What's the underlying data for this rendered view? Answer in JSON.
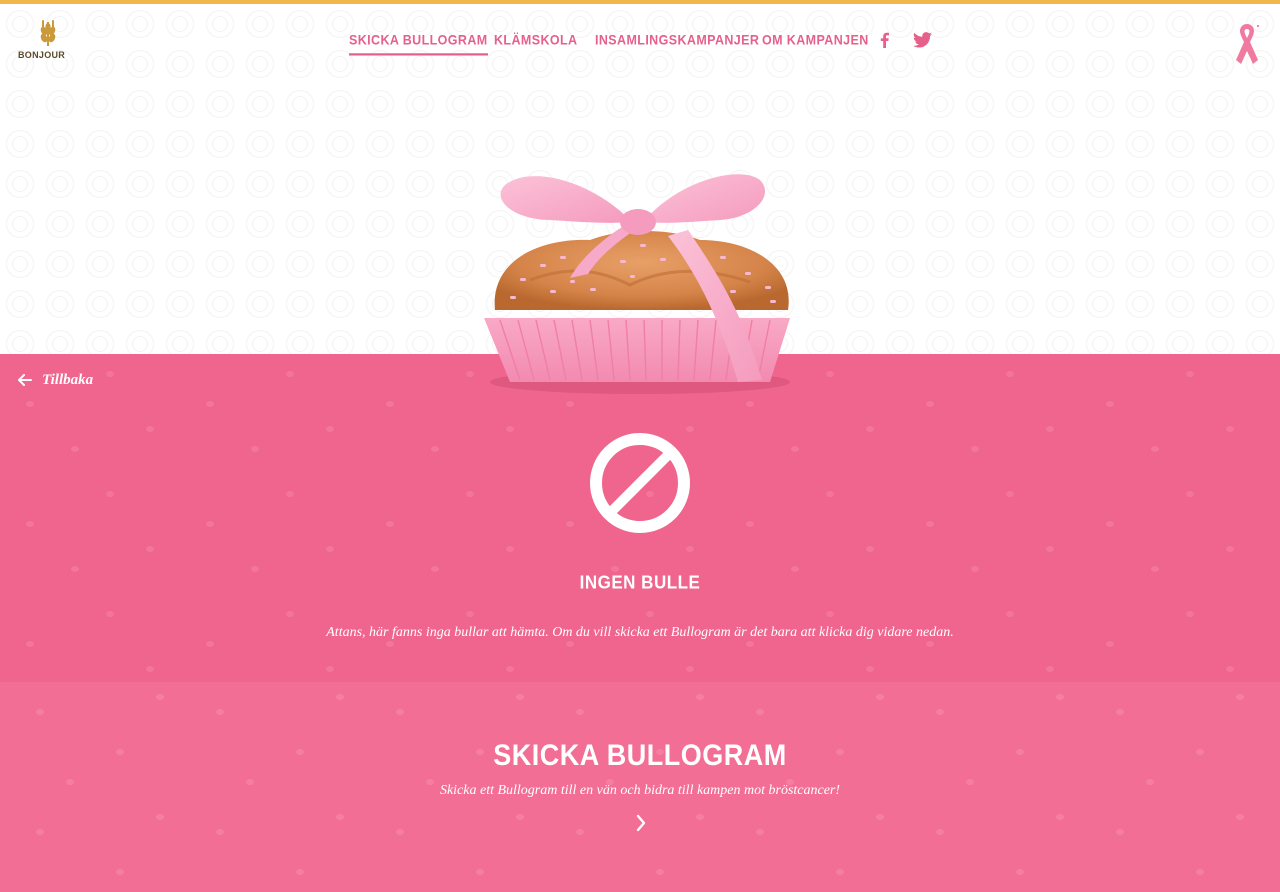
{
  "brand": {
    "logo_text": "BONJOUR",
    "accent_color": "#f0b84c",
    "pink": "#ef658d"
  },
  "nav": {
    "items": [
      {
        "label": "SKICKA BULLOGRAM",
        "active": true
      },
      {
        "label": "KLÄMSKOLA",
        "active": false
      },
      {
        "label": "INSAMLINGSKAMPANJER",
        "active": false
      },
      {
        "label": "OM KAMPANJEN",
        "active": false
      }
    ],
    "social": [
      "facebook-icon",
      "twitter-icon"
    ],
    "ribbon_icon": "pink-ribbon-icon"
  },
  "hero": {
    "image": "pink-bun-with-bow"
  },
  "back": {
    "label": "Tillbaka",
    "icon": "arrow-left-icon"
  },
  "error": {
    "icon": "no-entry-icon",
    "title": "INGEN BULLE",
    "text": "Attans, här fanns inga bullar att hämta. Om du vill skicka ett Bullogram är det bara att klicka dig vidare nedan."
  },
  "cta": {
    "title": "SKICKA BULLOGRAM",
    "text": "Skicka ett Bullogram till en vän och bidra till kampen mot bröstcancer!",
    "icon": "chevron-right-icon"
  }
}
